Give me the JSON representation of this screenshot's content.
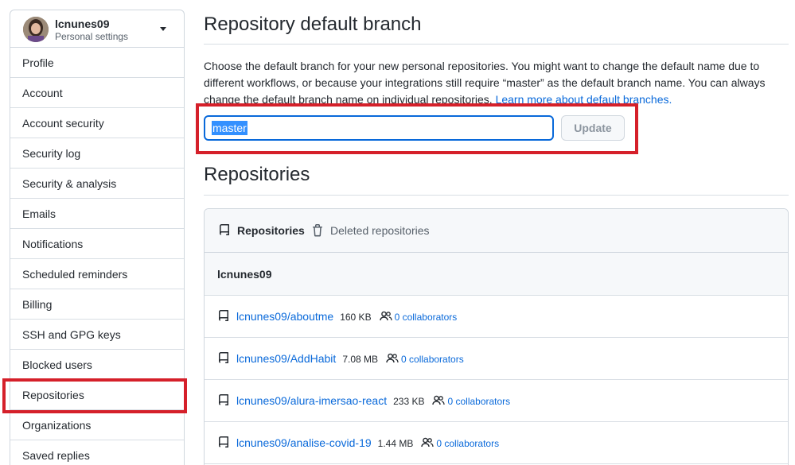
{
  "user": {
    "name": "lcnunes09",
    "subtitle": "Personal settings"
  },
  "sidebar": {
    "items": [
      {
        "label": "Profile"
      },
      {
        "label": "Account"
      },
      {
        "label": "Account security"
      },
      {
        "label": "Security log"
      },
      {
        "label": "Security & analysis"
      },
      {
        "label": "Emails"
      },
      {
        "label": "Notifications"
      },
      {
        "label": "Scheduled reminders"
      },
      {
        "label": "Billing"
      },
      {
        "label": "SSH and GPG keys"
      },
      {
        "label": "Blocked users"
      },
      {
        "label": "Repositories"
      },
      {
        "label": "Organizations"
      },
      {
        "label": "Saved replies"
      }
    ],
    "active": "Repositories"
  },
  "default_branch": {
    "title": "Repository default branch",
    "description": "Choose the default branch for your new personal repositories. You might want to change the default name due to different workflows, or because your integrations still require “master” as the default branch name. You can always change the default branch name on individual repositories.",
    "link_text": "Learn more about default branches.",
    "input_value": "master",
    "update_label": "Update"
  },
  "repositories": {
    "title": "Repositories",
    "tabs": {
      "active": "Repositories",
      "deleted": "Deleted repositories"
    },
    "owner": "lcnunes09",
    "rows": [
      {
        "name": "lcnunes09/aboutme",
        "size": "160 KB",
        "collaborators": "0 collaborators"
      },
      {
        "name": "lcnunes09/AddHabit",
        "size": "7.08 MB",
        "collaborators": "0 collaborators"
      },
      {
        "name": "lcnunes09/alura-imersao-react",
        "size": "233 KB",
        "collaborators": "0 collaborators"
      },
      {
        "name": "lcnunes09/analise-covid-19",
        "size": "1.44 MB",
        "collaborators": "0 collaborators"
      }
    ]
  },
  "colors": {
    "highlight": "#d5202a",
    "link": "#0969da",
    "text": "#24292f",
    "border": "#d0d7de"
  }
}
